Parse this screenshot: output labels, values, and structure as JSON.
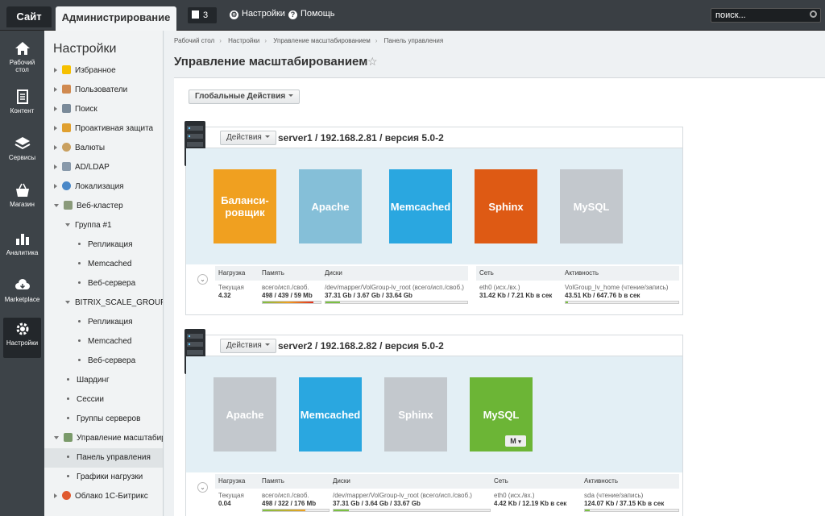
{
  "topbar": {
    "site_tab": "Сайт",
    "admin_tab": "Администрирование",
    "notifications_count": "3",
    "settings_link": "Настройки",
    "help_link": "Помощь",
    "search_placeholder": "поиск..."
  },
  "iconbar": [
    {
      "label": "Рабочий стол",
      "icon": "home-icon"
    },
    {
      "label": "Контент",
      "icon": "content-icon"
    },
    {
      "label": "Сервисы",
      "icon": "layers-icon"
    },
    {
      "label": "Магазин",
      "icon": "basket-icon"
    },
    {
      "label": "Аналитика",
      "icon": "bar-chart-icon"
    },
    {
      "label": "Marketplace",
      "icon": "cloud-download-icon"
    },
    {
      "label": "Настройки",
      "icon": "gear-icon",
      "active": true
    }
  ],
  "sidebar": {
    "title": "Настройки",
    "items": [
      {
        "label": "Избранное"
      },
      {
        "label": "Пользователи"
      },
      {
        "label": "Поиск"
      },
      {
        "label": "Проактивная защита"
      },
      {
        "label": "Валюты"
      },
      {
        "label": "AD/LDAP"
      },
      {
        "label": "Локализация"
      },
      {
        "label": "Веб-кластер"
      },
      {
        "label": "Группа #1"
      },
      {
        "label": "Репликация"
      },
      {
        "label": "Memcached"
      },
      {
        "label": "Веб-сервера"
      },
      {
        "label": "BITRIX_SCALE_GROUP"
      },
      {
        "label": "Репликация"
      },
      {
        "label": "Memcached"
      },
      {
        "label": "Веб-сервера"
      },
      {
        "label": "Шардинг"
      },
      {
        "label": "Сессии"
      },
      {
        "label": "Группы серверов"
      },
      {
        "label": "Управление масштабирова"
      },
      {
        "label": "Панель управления"
      },
      {
        "label": "Графики нагрузки"
      },
      {
        "label": "Облако 1С-Битрикс"
      }
    ]
  },
  "breadcrumb": [
    "Рабочий стол",
    "Настройки",
    "Управление масштабированием",
    "Панель управления"
  ],
  "page_title": "Управление масштабированием",
  "global_actions": "Глобальные Действия",
  "actions_label": "Действия",
  "stat_headers": {
    "load": "Нагрузка",
    "memory": "Память",
    "disks": "Диски",
    "network": "Сеть",
    "activity": "Активность"
  },
  "servers": [
    {
      "title": "server1 / 192.168.2.81 / версия 5.0-2",
      "tiles": [
        {
          "label": "Баланси-\nровщик",
          "color": "#f0a020"
        },
        {
          "label": "Apache",
          "color": "#85bfd8"
        },
        {
          "label": "Memcached",
          "color": "#2aa7e0"
        },
        {
          "label": "Sphinx",
          "color": "#de5a14"
        },
        {
          "label": "MySQL",
          "color": "#c3c8cd"
        }
      ],
      "load_sub": "Текущая",
      "load_val": "4.32",
      "memory_sub": "всего/исп./своб.",
      "memory_val": "498 / 439 / 59 Mb",
      "memory_fill": 0.88,
      "disks_sub": "/dev/mapper/VolGroup-lv_root (всего/исп./своб.)",
      "disks_val": "37.31 Gb / 3.67 Gb / 33.64 Gb",
      "disks_fill": 0.1,
      "network_sub": "eth0 (исх./вх.)",
      "network_val": "31.42 Kb / 7.21 Kb в сек",
      "activity_sub": "VolGroup_lv_home (чтение/запись)",
      "activity_val": "43.51 Kb / 647.76 b в сек",
      "activity_fill": 0.02
    },
    {
      "title": "server2 / 192.168.2.82 / версия 5.0-2",
      "tiles": [
        {
          "label": "Apache",
          "color": "#c3c8cd"
        },
        {
          "label": "Memcached",
          "color": "#2aa7e0"
        },
        {
          "label": "Sphinx",
          "color": "#c3c8cd"
        },
        {
          "label": "MySQL",
          "color": "#6cb536",
          "badge": "M"
        }
      ],
      "load_sub": "Текущая",
      "load_val": "0.04",
      "memory_sub": "всего/исп./своб.",
      "memory_val": "498 / 322 / 176 Mb",
      "memory_fill": 0.65,
      "disks_sub": "/dev/mapper/VolGroup-lv_root (всего/исп./своб.)",
      "disks_val": "37.31 Gb / 3.64 Gb / 33.67 Gb",
      "disks_fill": 0.1,
      "network_sub": "eth0 (исх./вх.)",
      "network_val": "4.42 Kb / 12.19 Kb в сек",
      "activity_sub": "sda (чтение/запись)",
      "activity_val": "124.07 Kb / 37.15 Kb в сек",
      "activity_fill": 0.05
    }
  ]
}
